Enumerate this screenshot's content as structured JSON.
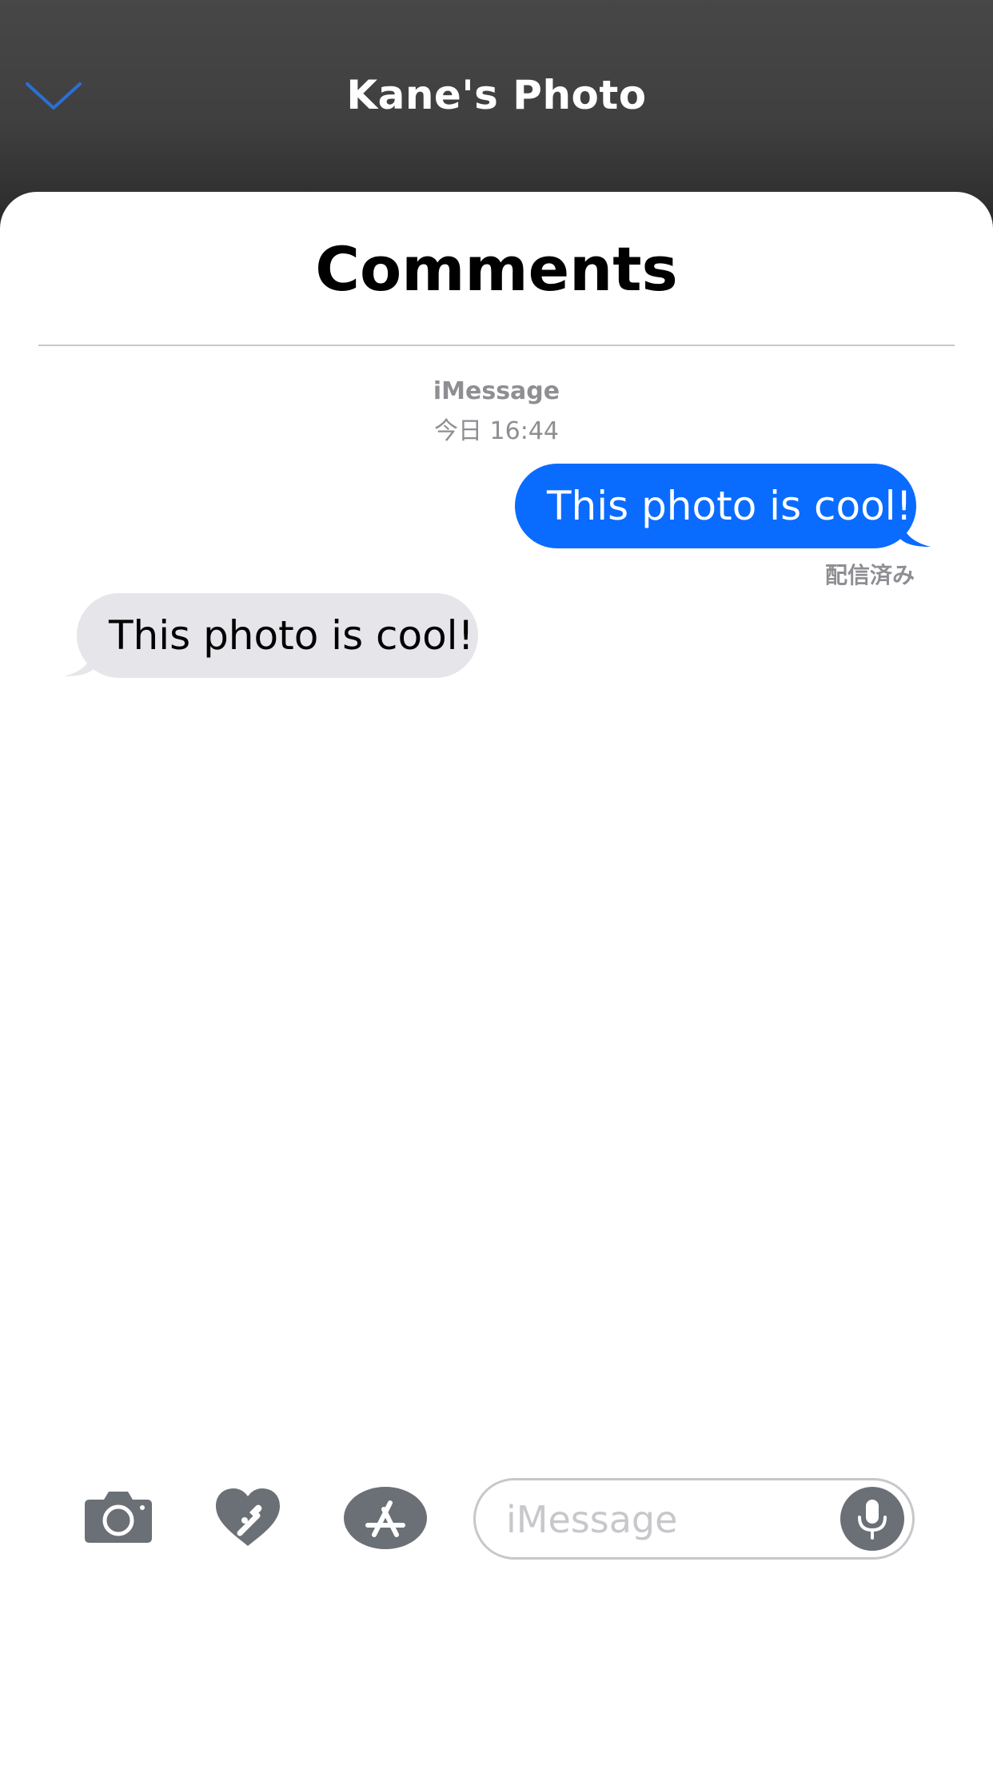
{
  "header": {
    "title": "Kane's Photo",
    "collapse_icon": "chevron-down-icon",
    "accent_color": "#2b6fd6"
  },
  "sheet": {
    "title": "Comments"
  },
  "conversation": {
    "service": "iMessage",
    "timestamp": "今日 16:44",
    "messages": [
      {
        "direction": "outgoing",
        "text": "This photo is cool!",
        "bubble_color": "#0a6cff"
      },
      {
        "direction": "incoming",
        "text": "This photo is cool!",
        "bubble_color": "#e5e5ea"
      }
    ],
    "delivery_status": "配信済み"
  },
  "compose": {
    "placeholder": "iMessage",
    "value": "",
    "icons": [
      "camera-icon",
      "digital-touch-icon",
      "app-store-icon",
      "microphone-icon"
    ]
  }
}
